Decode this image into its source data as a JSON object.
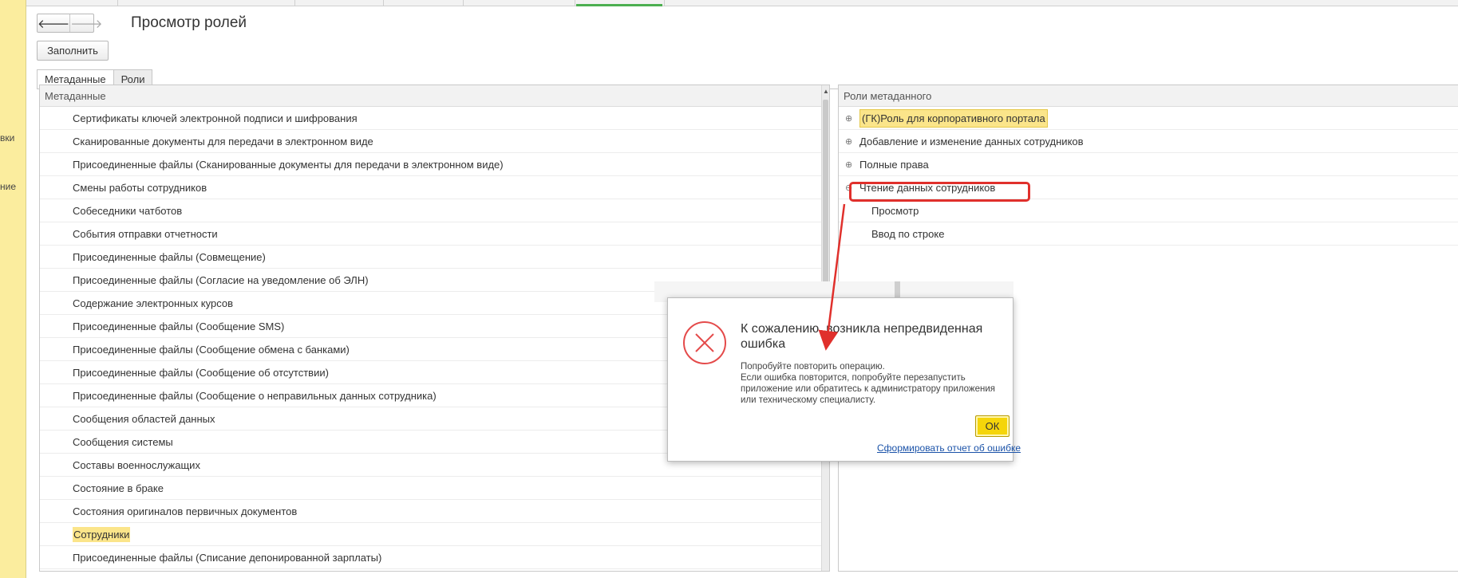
{
  "left_strip": {
    "cut_labels": [
      "вки",
      "ние"
    ]
  },
  "header": {
    "back_symbol": "🡐",
    "forward_symbol": "🡒",
    "title": "Просмотр ролей"
  },
  "toolbar": {
    "fill_label": "Заполнить"
  },
  "tabs": [
    {
      "label": "Метаданные"
    },
    {
      "label": "Роли"
    }
  ],
  "metadata_table": {
    "header": "Метаданные",
    "rows": [
      "Сертификаты ключей электронной подписи и шифрования",
      "Сканированные документы для передачи в электронном виде",
      "Присоединенные файлы (Сканированные документы для передачи в электронном виде)",
      "Смены работы сотрудников",
      "Собеседники чатботов",
      "События отправки отчетности",
      "Присоединенные файлы (Совмещение)",
      "Присоединенные файлы (Согласие на уведомление об ЭЛН)",
      "Содержание электронных курсов",
      "Присоединенные файлы (Сообщение SMS)",
      "Присоединенные файлы (Сообщение обмена с банками)",
      "Присоединенные файлы (Сообщение об отсутствии)",
      "Присоединенные файлы (Сообщение о неправильных данных сотрудника)",
      "Сообщения областей данных",
      "Сообщения системы",
      "Составы военнослужащих",
      "Состояние в браке",
      "Состояния оригиналов первичных документов",
      "Сотрудники",
      "Присоединенные файлы (Списание депонированной зарплаты)"
    ],
    "selected_row": "Сотрудники"
  },
  "roles_table": {
    "header": "Роли метаданного",
    "rows": [
      {
        "label": "(ГК)Роль для корпоративного портала",
        "expander": "⊕",
        "highlight": true
      },
      {
        "label": "Добавление и изменение данных сотрудников",
        "expander": "⊕"
      },
      {
        "label": "Полные права",
        "expander": "⊕"
      },
      {
        "label": "Чтение данных сотрудников",
        "expander": "⊖"
      },
      {
        "label": "Просмотр",
        "child": true
      },
      {
        "label": "Ввод по строке",
        "child": true
      }
    ]
  },
  "dialog": {
    "title": "К сожалению, возникла непредвиденная ошибка",
    "message": "Попробуйте повторить операцию.\nЕсли ошибка повторится, попробуйте перезапустить приложение или обратитесь к администратору приложения или техническому специалисту.",
    "ok_label": "ОК",
    "report_link": "Сформировать отчет об ошибке"
  },
  "colors": {
    "accent_yellow": "#fbe58a",
    "ok_button": "#f5d50a",
    "annotation_red": "#e0302c",
    "error_red": "#e44a4a",
    "link_blue": "#1a52a8"
  }
}
